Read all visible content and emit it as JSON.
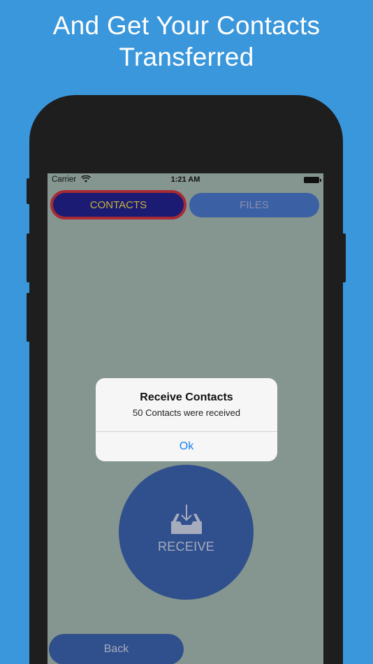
{
  "headline": {
    "line1": "And Get Your Contacts",
    "line2": "Transferred"
  },
  "statusbar": {
    "carrier": "Carrier",
    "time": "1:21 AM",
    "wifi_icon": "wifi-icon",
    "battery_icon": "battery-icon"
  },
  "tabs": [
    {
      "label": "CONTACTS",
      "selected": true
    },
    {
      "label": "FILES",
      "selected": false
    }
  ],
  "receive": {
    "label": "RECEIVE",
    "icon": "inbox-download-icon"
  },
  "back_label": "Back",
  "alert": {
    "title": "Receive Contacts",
    "message": "50 Contacts were received",
    "ok_label": "Ok"
  },
  "colors": {
    "background": "#3a97db",
    "screen": "#85958f",
    "selected_tab": "#1b1b73",
    "selected_tab_border": "#a82a35",
    "selected_tab_text": "#c8b33a",
    "button": "#304f8d",
    "alert_action": "#1a7ef2"
  }
}
